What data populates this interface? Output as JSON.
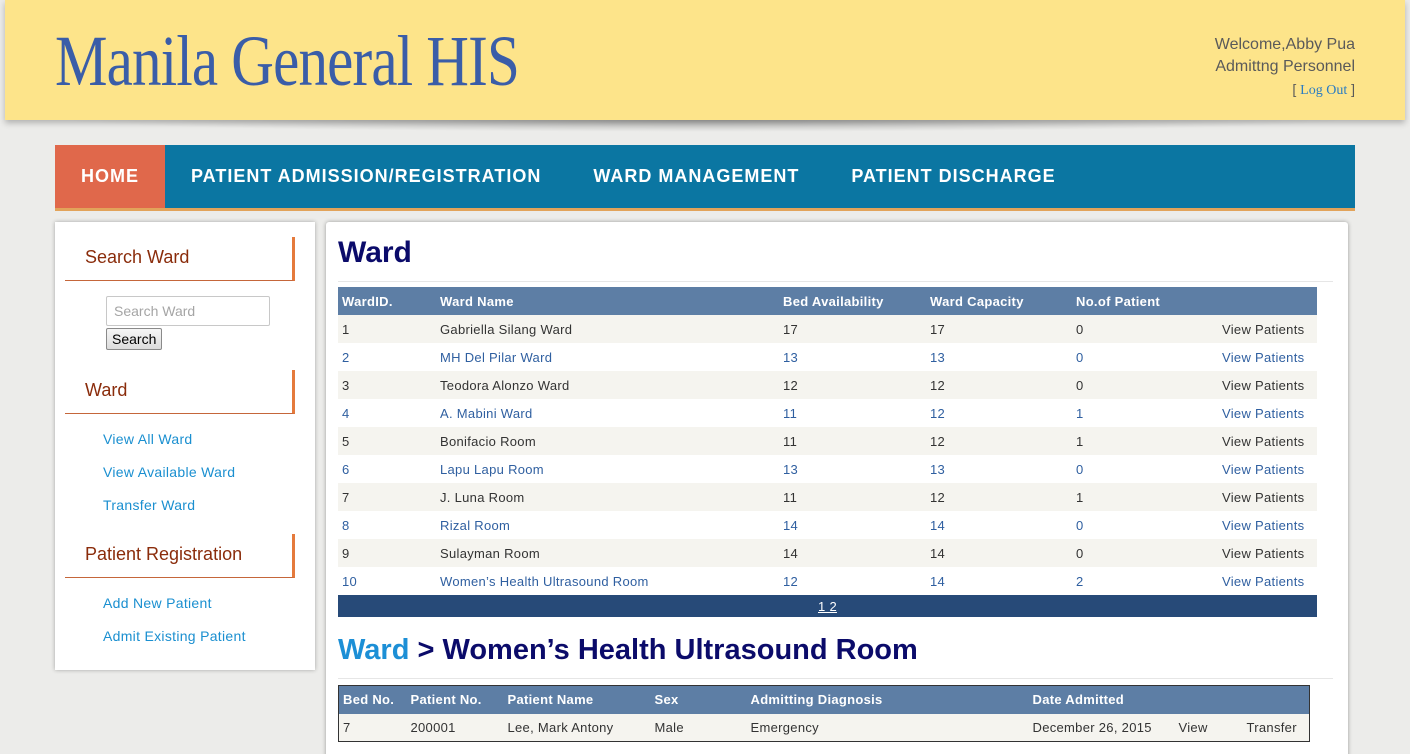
{
  "header": {
    "logo": "Manila General HIS",
    "welcome": "Welcome,Abby Pua",
    "role": "Admittng Personnel",
    "logout_open": "[",
    "logout": "Log Out",
    "logout_close": "]"
  },
  "nav": {
    "items": [
      {
        "label": "HOME"
      },
      {
        "label": "PATIENT ADMISSION/REGISTRATION"
      },
      {
        "label": "WARD MANAGEMENT"
      },
      {
        "label": "PATIENT DISCHARGE"
      }
    ]
  },
  "sidebar": {
    "search_heading": "Search Ward",
    "search_placeholder": "Search Ward",
    "search_button": "Search",
    "ward_heading": "Ward",
    "ward_links": [
      "View All Ward",
      "View Available Ward",
      "Transfer Ward"
    ],
    "patient_heading": "Patient Registration",
    "patient_links": [
      "Add New Patient",
      "Admit Existing Patient"
    ]
  },
  "main": {
    "title": "Ward",
    "ward_table": {
      "headers": [
        "WardID.",
        "Ward Name",
        "Bed Availability",
        "Ward Capacity",
        "No.of Patient",
        ""
      ],
      "rows": [
        [
          "1",
          "Gabriella Silang Ward",
          "17",
          "17",
          "0",
          "View Patients"
        ],
        [
          "2",
          "MH Del Pilar Ward",
          "13",
          "13",
          "0",
          "View Patients"
        ],
        [
          "3",
          "Teodora Alonzo Ward",
          "12",
          "12",
          "0",
          "View Patients"
        ],
        [
          "4",
          "A. Mabini Ward",
          "11",
          "12",
          "1",
          "View Patients"
        ],
        [
          "5",
          "Bonifacio Room",
          "11",
          "12",
          "1",
          "View Patients"
        ],
        [
          "6",
          "Lapu Lapu Room",
          "13",
          "13",
          "0",
          "View Patients"
        ],
        [
          "7",
          "J. Luna Room",
          "11",
          "12",
          "1",
          "View Patients"
        ],
        [
          "8",
          "Rizal Room",
          "14",
          "14",
          "0",
          "View Patients"
        ],
        [
          "9",
          "Sulayman Room",
          "14",
          "14",
          "0",
          "View Patients"
        ],
        [
          "10",
          "Women’s Health Ultrasound Room",
          "12",
          "14",
          "2",
          "View Patients"
        ]
      ],
      "pager": "1 2"
    },
    "subtitle_crumb": "Ward",
    "subtitle_rest": " > Women’s Health Ultrasound Room",
    "patient_table": {
      "headers": [
        "Bed No.",
        "Patient No.",
        "Patient Name",
        "Sex",
        "Admitting Diagnosis",
        "Date Admitted",
        "",
        ""
      ],
      "rows": [
        [
          "7",
          "200001",
          "Lee, Mark Antony",
          "Male",
          "Emergency",
          "December 26, 2015",
          "View",
          "Transfer"
        ]
      ]
    }
  }
}
